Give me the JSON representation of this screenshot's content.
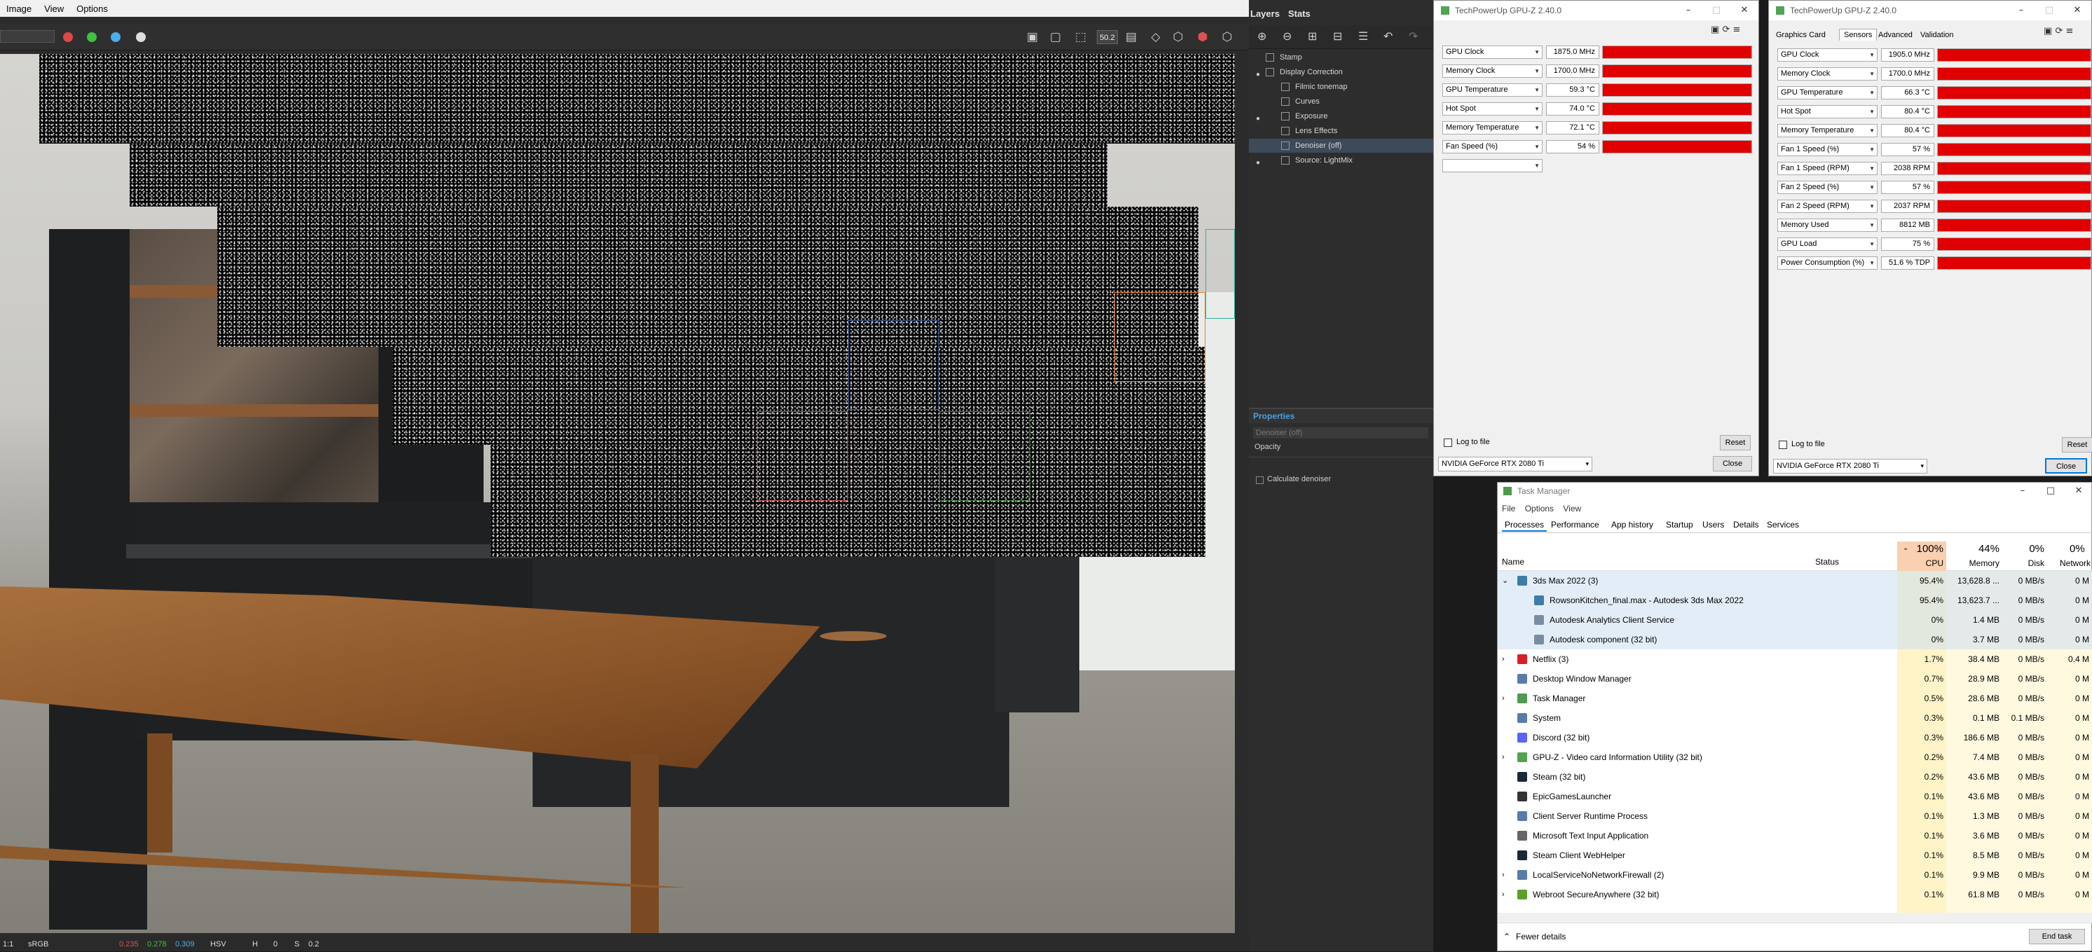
{
  "vfb": {
    "menu": [
      "Image",
      "View",
      "Options"
    ],
    "zoom": "50.2",
    "status": [
      "1:1",
      "sRGB",
      "",
      "0.235",
      "0.278",
      "0.309",
      "HSV",
      "H",
      "0",
      "S",
      "0.2"
    ],
    "colors": {
      "red": "#e04848",
      "green": "#3fc23f",
      "blue": "#4aaeea"
    }
  },
  "layers": {
    "tabs": [
      "Layers",
      "Stats"
    ],
    "items": [
      {
        "label": "Stamp",
        "visible": false
      },
      {
        "label": "Display Correction",
        "visible": true
      },
      {
        "label": "Filmic tonemap",
        "visible": false
      },
      {
        "label": "Curves",
        "visible": false
      },
      {
        "label": "Exposure",
        "visible": true
      },
      {
        "label": "Lens Effects",
        "visible": false
      },
      {
        "label": "Denoiser (off)",
        "visible": false
      },
      {
        "label": "Source: LightMix",
        "visible": true
      }
    ],
    "properties": {
      "title": "Properties",
      "name_field": "Denoiser (off)",
      "opacity_label": "Opacity",
      "calculate_label": "Calculate denoiser"
    }
  },
  "gpuz1": {
    "title": "TechPowerUp GPU-Z 2.40.0",
    "sensors": [
      {
        "name": "GPU Clock",
        "value": "1875.0 MHz"
      },
      {
        "name": "Memory Clock",
        "value": "1700.0 MHz"
      },
      {
        "name": "GPU Temperature",
        "value": "59.3 °C"
      },
      {
        "name": "Hot Spot",
        "value": "74.0 °C"
      },
      {
        "name": "Memory Temperature",
        "value": "72.1 °C"
      },
      {
        "name": "Fan Speed (%)",
        "value": "54 %"
      },
      {
        "name": "",
        "value": ""
      }
    ],
    "log_label": "Log to file",
    "reset": "Reset",
    "close": "Close",
    "gpu": "NVIDIA GeForce RTX 2080 Ti"
  },
  "gpuz2": {
    "title": "TechPowerUp GPU-Z 2.40.0",
    "tabs": [
      "Graphics Card",
      "Sensors",
      "Advanced",
      "Validation"
    ],
    "sensors": [
      {
        "name": "GPU Clock",
        "value": "1905.0 MHz"
      },
      {
        "name": "Memory Clock",
        "value": "1700.0 MHz"
      },
      {
        "name": "GPU Temperature",
        "value": "66.3 °C"
      },
      {
        "name": "Hot Spot",
        "value": "80.4 °C"
      },
      {
        "name": "Memory Temperature",
        "value": "80.4 °C"
      },
      {
        "name": "Fan 1 Speed (%)",
        "value": "57 %"
      },
      {
        "name": "Fan 1 Speed (RPM)",
        "value": "2038 RPM"
      },
      {
        "name": "Fan 2 Speed (%)",
        "value": "57 %"
      },
      {
        "name": "Fan 2 Speed (RPM)",
        "value": "2037 RPM"
      },
      {
        "name": "Memory Used",
        "value": "8812 MB"
      },
      {
        "name": "GPU Load",
        "value": "75 %"
      },
      {
        "name": "Power Consumption (%)",
        "value": "51.6 % TDP"
      }
    ],
    "log_label": "Log to file",
    "reset": "Reset",
    "close": "Close",
    "gpu": "NVIDIA GeForce RTX 2080 Ti"
  },
  "taskmgr": {
    "title": "Task Manager",
    "menu": [
      "File",
      "Options",
      "View"
    ],
    "tabs": [
      "Processes",
      "Performance",
      "App history",
      "Startup",
      "Users",
      "Details",
      "Services"
    ],
    "headers": {
      "name": "Name",
      "status": "Status",
      "cpu_pct": "100%",
      "cpu": "CPU",
      "mem_pct": "44%",
      "mem": "Memory",
      "disk_pct": "0%",
      "disk": "Disk",
      "net_pct": "0%",
      "net": "Network"
    },
    "rows": [
      {
        "name": "3ds Max 2022 (3)",
        "cpu": "95.4%",
        "mem": "13,628.8 ...",
        "disk": "0 MB/s",
        "net": "0 M",
        "expand": "v",
        "indent": 0,
        "icon": "#3a7ea8"
      },
      {
        "name": "RowsonKitchen_final.max - Autodesk 3ds Max 2022",
        "cpu": "95.4%",
        "mem": "13,623.7 ...",
        "disk": "0 MB/s",
        "net": "0 M",
        "expand": "",
        "indent": 1,
        "icon": "#3a7ea8"
      },
      {
        "name": "Autodesk Analytics Client Service",
        "cpu": "0%",
        "mem": "1.4 MB",
        "disk": "0 MB/s",
        "net": "0 M",
        "expand": "",
        "indent": 1,
        "icon": "#7a8da0"
      },
      {
        "name": "Autodesk component (32 bit)",
        "cpu": "0%",
        "mem": "3.7 MB",
        "disk": "0 MB/s",
        "net": "0 M",
        "expand": "",
        "indent": 1,
        "icon": "#7a8da0"
      },
      {
        "name": "Netflix (3)",
        "cpu": "1.7%",
        "mem": "38.4 MB",
        "disk": "0 MB/s",
        "net": "0.4 M",
        "expand": ">",
        "indent": 0,
        "icon": "#d81f26"
      },
      {
        "name": "Desktop Window Manager",
        "cpu": "0.7%",
        "mem": "28.9 MB",
        "disk": "0 MB/s",
        "net": "0 M",
        "expand": "",
        "indent": 0,
        "icon": "#5a7ba8"
      },
      {
        "name": "Task Manager",
        "cpu": "0.5%",
        "mem": "28.6 MB",
        "disk": "0 MB/s",
        "net": "0 M",
        "expand": ">",
        "indent": 0,
        "icon": "#4e9a4e"
      },
      {
        "name": "System",
        "cpu": "0.3%",
        "mem": "0.1 MB",
        "disk": "0.1 MB/s",
        "net": "0 M",
        "expand": "",
        "indent": 0,
        "icon": "#5a7ba8"
      },
      {
        "name": "Discord (32 bit)",
        "cpu": "0.3%",
        "mem": "186.6 MB",
        "disk": "0 MB/s",
        "net": "0 M",
        "expand": "",
        "indent": 0,
        "icon": "#5865f2"
      },
      {
        "name": "GPU-Z - Video card Information Utility (32 bit)",
        "cpu": "0.2%",
        "mem": "7.4 MB",
        "disk": "0 MB/s",
        "net": "0 M",
        "expand": ">",
        "indent": 0,
        "icon": "#52a352"
      },
      {
        "name": "Steam (32 bit)",
        "cpu": "0.2%",
        "mem": "43.6 MB",
        "disk": "0 MB/s",
        "net": "0 M",
        "expand": "",
        "indent": 0,
        "icon": "#1b2838"
      },
      {
        "name": "EpicGamesLauncher",
        "cpu": "0.1%",
        "mem": "43.6 MB",
        "disk": "0 MB/s",
        "net": "0 M",
        "expand": "",
        "indent": 0,
        "icon": "#333333"
      },
      {
        "name": "Client Server Runtime Process",
        "cpu": "0.1%",
        "mem": "1.3 MB",
        "disk": "0 MB/s",
        "net": "0 M",
        "expand": "",
        "indent": 0,
        "icon": "#5a7ba8"
      },
      {
        "name": "Microsoft Text Input Application",
        "cpu": "0.1%",
        "mem": "3.6 MB",
        "disk": "0 MB/s",
        "net": "0 M",
        "expand": "",
        "indent": 0,
        "icon": "#666666"
      },
      {
        "name": "Steam Client WebHelper",
        "cpu": "0.1%",
        "mem": "8.5 MB",
        "disk": "0 MB/s",
        "net": "0 M",
        "expand": "",
        "indent": 0,
        "icon": "#1b2838"
      },
      {
        "name": "LocalServiceNoNetworkFirewall (2)",
        "cpu": "0.1%",
        "mem": "9.9 MB",
        "disk": "0 MB/s",
        "net": "0 M",
        "expand": ">",
        "indent": 0,
        "icon": "#5a7ba8"
      },
      {
        "name": "Webroot SecureAnywhere (32 bit)",
        "cpu": "0.1%",
        "mem": "61.8 MB",
        "disk": "0 MB/s",
        "net": "0 M",
        "expand": ">",
        "indent": 0,
        "icon": "#5aa02c"
      }
    ],
    "fewer_details": "Fewer details",
    "end_task": "End task"
  }
}
